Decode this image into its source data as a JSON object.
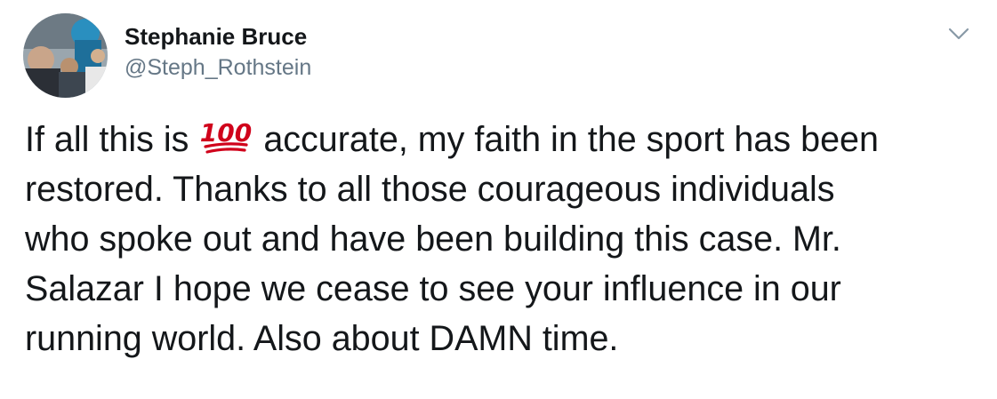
{
  "author": {
    "display_name": "Stephanie Bruce",
    "handle": "@Steph_Rothstein",
    "avatar_icon": "profile-photo"
  },
  "menu": {
    "icon": "chevron-down-icon"
  },
  "tweet": {
    "lines": [
      {
        "before": "If all this is ",
        "emoji": "hundred-points-emoji",
        "after": " accurate, my faith in the sport has been"
      },
      {
        "text": "restored. Thanks to all those courageous individuals"
      },
      {
        "text": "who spoke out and have been building this case. Mr."
      },
      {
        "text": "Salazar I hope we cease to see your influence in our"
      },
      {
        "text": "running world. Also about DAMN time."
      }
    ]
  },
  "colors": {
    "text": "#14171a",
    "secondary": "#657786",
    "emoji_red": "#d0021b"
  }
}
